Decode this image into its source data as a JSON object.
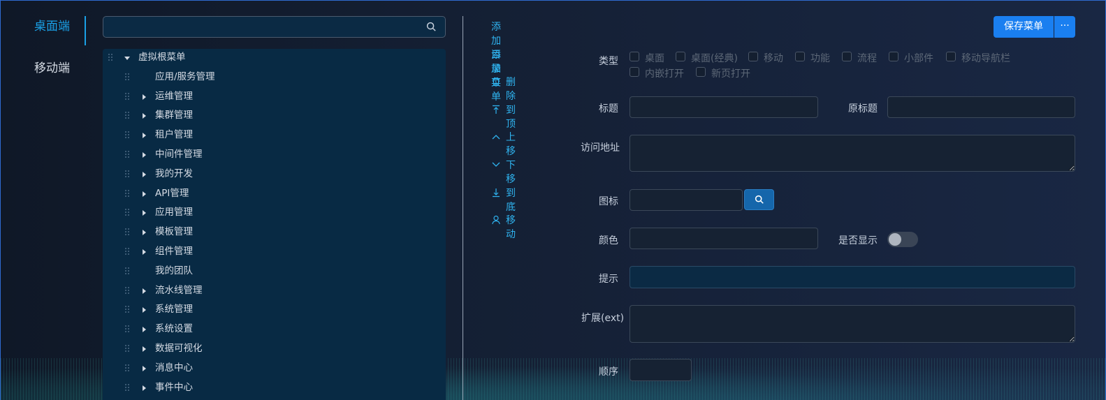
{
  "nav": {
    "items": [
      "桌面端",
      "移动端"
    ],
    "active": 0
  },
  "tree": {
    "search": {
      "placeholder": "",
      "value": ""
    },
    "root": "虚拟根菜单",
    "items": [
      {
        "label": "应用/服务管理",
        "expandable": false
      },
      {
        "label": "运维管理",
        "expandable": true
      },
      {
        "label": "集群管理",
        "expandable": true
      },
      {
        "label": "租户管理",
        "expandable": true
      },
      {
        "label": "中间件管理",
        "expandable": true
      },
      {
        "label": "我的开发",
        "expandable": true
      },
      {
        "label": "API管理",
        "expandable": true
      },
      {
        "label": "应用管理",
        "expandable": true
      },
      {
        "label": "模板管理",
        "expandable": true
      },
      {
        "label": "组件管理",
        "expandable": true
      },
      {
        "label": "我的团队",
        "expandable": false
      },
      {
        "label": "流水线管理",
        "expandable": true
      },
      {
        "label": "系统管理",
        "expandable": true
      },
      {
        "label": "系统设置",
        "expandable": true
      },
      {
        "label": "数据可视化",
        "expandable": true
      },
      {
        "label": "消息中心",
        "expandable": true
      },
      {
        "label": "事件中心",
        "expandable": true
      }
    ]
  },
  "actions": {
    "add_dir": "添加目录",
    "add_menu": "添加菜单",
    "delete": "删除",
    "to_top": "到顶",
    "move_up": "上移",
    "move_down": "下移",
    "to_bottom": "到底",
    "move": "移动"
  },
  "toolbar": {
    "save": "保存菜单",
    "more": "···"
  },
  "form": {
    "type_label": "类型",
    "type_options": [
      "桌面",
      "桌面(经典)",
      "移动",
      "功能",
      "流程",
      "小部件",
      "移动导航栏",
      "内嵌打开",
      "新页打开"
    ],
    "title_label": "标题",
    "title_value": "",
    "orig_title_label": "原标题",
    "orig_title_value": "",
    "url_label": "访问地址",
    "url_value": "",
    "icon_label": "图标",
    "icon_value": "",
    "color_label": "颜色",
    "color_value": "",
    "visible_label": "是否显示",
    "visible": false,
    "hint_label": "提示",
    "hint_value": "",
    "ext_label": "扩展(ext)",
    "ext_value": "",
    "order_label": "顺序",
    "order_value": ""
  },
  "colors": {
    "accent": "#1aa0e6",
    "primary_button": "#1a7ff0",
    "action_text": "#2fb4f0",
    "tree_bg": "#082a44"
  }
}
